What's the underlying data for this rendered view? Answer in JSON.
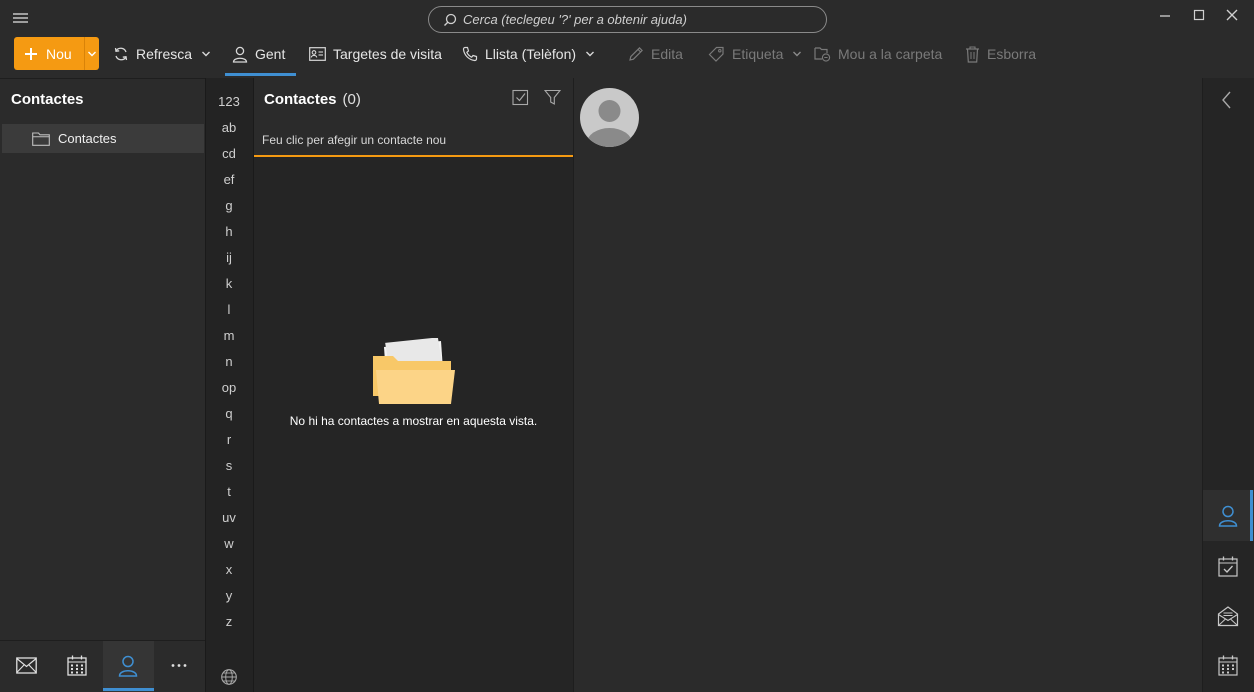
{
  "titlebar": {
    "search_placeholder": "Cerca (teclegeu '?' per a obtenir ajuda)"
  },
  "toolbar": {
    "new_label": "Nou",
    "refresh_label": "Refresca",
    "people_label": "Gent",
    "business_cards_label": "Targetes de visita",
    "list_phone_label": "Llista (Telèfon)",
    "edit_label": "Edita",
    "tag_label": "Etiqueta",
    "move_label": "Mou a la carpeta",
    "delete_label": "Esborra"
  },
  "folders": {
    "title": "Contactes",
    "items": [
      {
        "label": "Contactes"
      }
    ]
  },
  "alphabet": [
    "123",
    "ab",
    "cd",
    "ef",
    "g",
    "h",
    "ij",
    "k",
    "l",
    "m",
    "n",
    "op",
    "q",
    "r",
    "s",
    "t",
    "uv",
    "w",
    "x",
    "y",
    "z"
  ],
  "contact_list": {
    "title": "Contactes",
    "count": "(0)",
    "add_placeholder": "Feu clic per afegir un contacte nou",
    "empty_message": "No hi ha contactes a mostrar en aquesta vista."
  },
  "colors": {
    "accent": "#f59a12",
    "selection": "#3f8fd2",
    "background": "#2b2b2b"
  },
  "icons": [
    "hamburger-icon",
    "search-icon",
    "minimize-icon",
    "maximize-icon",
    "close-icon",
    "plus-icon",
    "refresh-icon",
    "person-icon",
    "business-card-icon",
    "phone-icon",
    "pencil-icon",
    "tag-icon",
    "move-folder-icon",
    "trash-icon",
    "folder-icon",
    "check-square-icon",
    "filter-icon",
    "globe-icon",
    "mail-icon",
    "calendar-icon",
    "more-icon",
    "collapse-left-icon",
    "task-icon",
    "envelope-open-icon",
    "avatar-placeholder",
    "empty-folder-illustration"
  ]
}
